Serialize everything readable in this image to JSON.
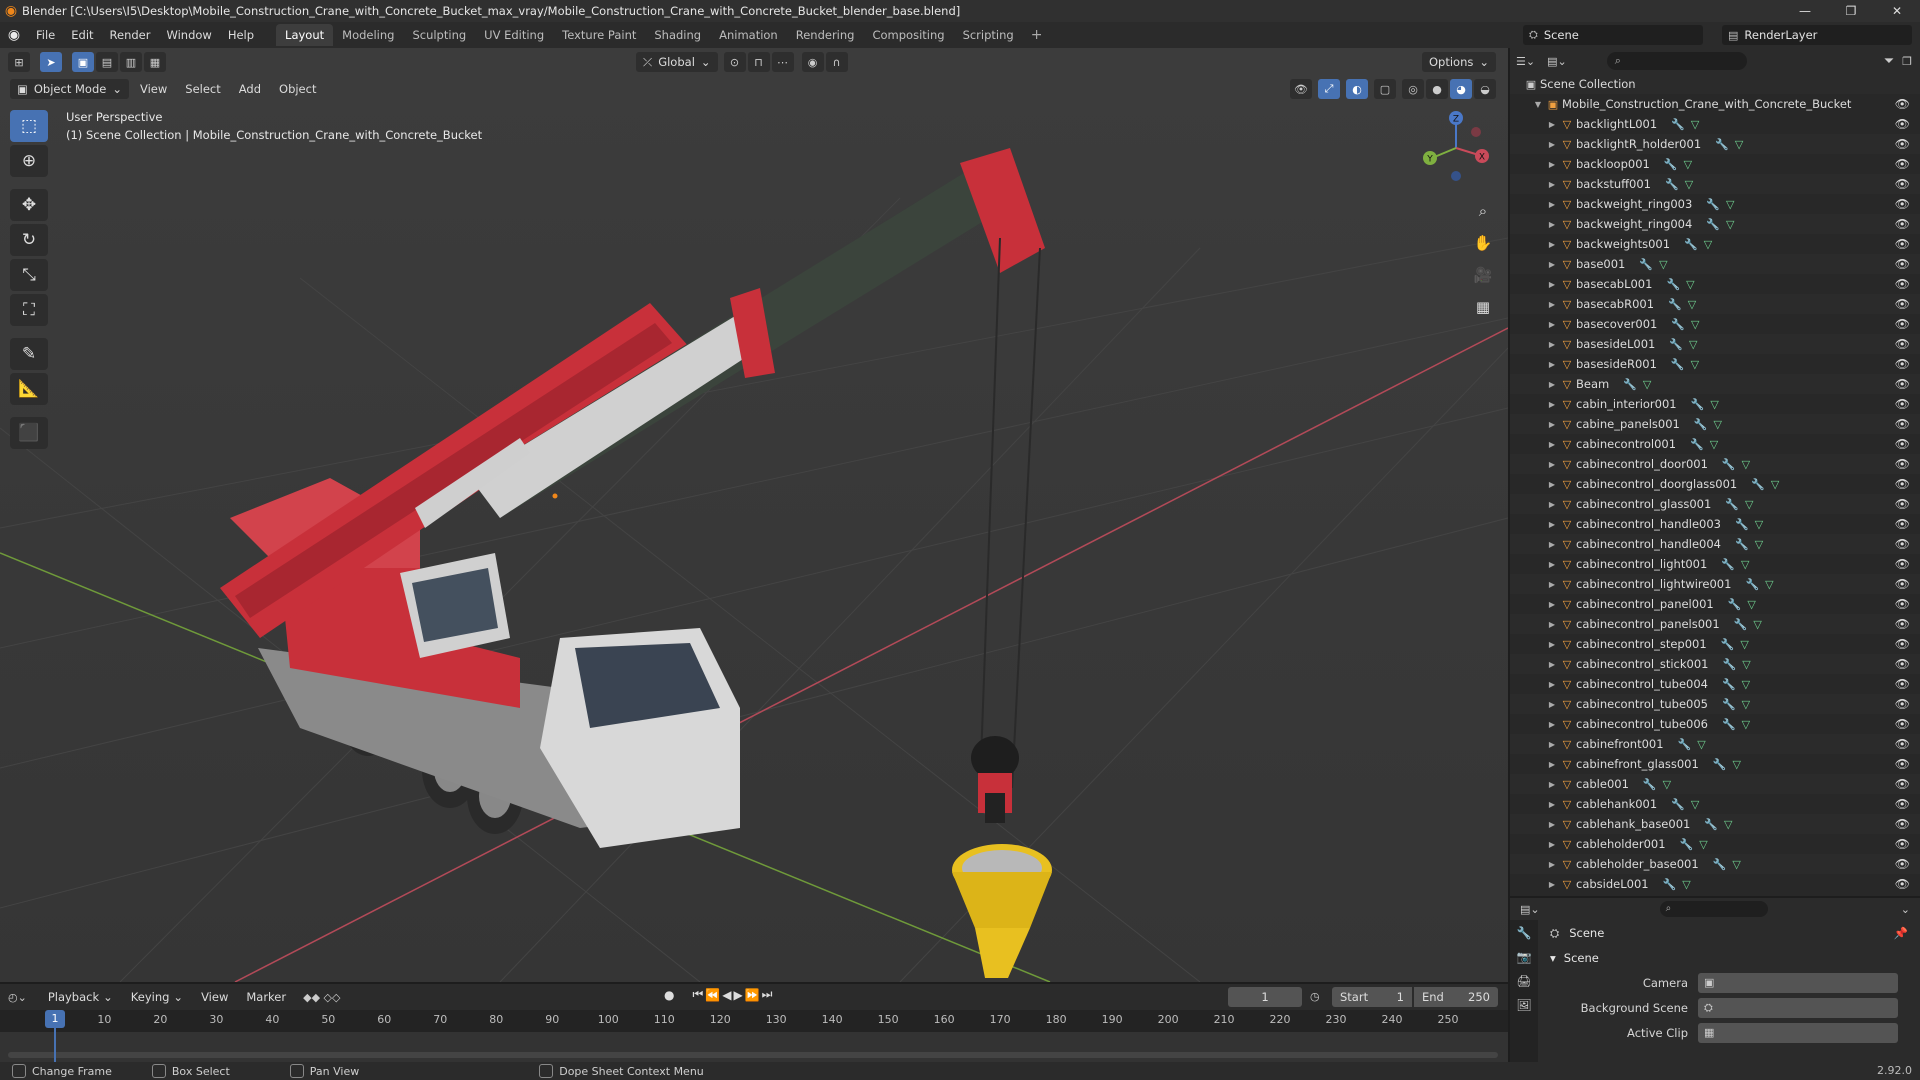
{
  "window": {
    "title": "Blender [C:\\Users\\I5\\Desktop\\Mobile_Construction_Crane_with_Concrete_Bucket_max_vray/Mobile_Construction_Crane_with_Concrete_Bucket_blender_base.blend]",
    "minimize": "—",
    "maximize": "❐",
    "close": "✕"
  },
  "menubar": {
    "menus": [
      "File",
      "Edit",
      "Render",
      "Window",
      "Help"
    ],
    "workspaces": [
      "Layout",
      "Modeling",
      "Sculpting",
      "UV Editing",
      "Texture Paint",
      "Shading",
      "Animation",
      "Rendering",
      "Compositing",
      "Scripting"
    ],
    "active_workspace": "Layout",
    "add": "+",
    "scene": "Scene",
    "render_layer": "RenderLayer"
  },
  "viewport": {
    "mode": "Object Mode",
    "menus": [
      "View",
      "Select",
      "Add",
      "Object"
    ],
    "transform_orientation": "Global",
    "options": "Options",
    "info_line1": "User Perspective",
    "info_line2": "(1) Scene Collection | Mobile_Construction_Crane_with_Concrete_Bucket",
    "gizmo": {
      "x": "X",
      "y": "Y",
      "z": "Z"
    }
  },
  "outliner": {
    "search_placeholder": "",
    "root": "Scene Collection",
    "collection": "Mobile_Construction_Crane_with_Concrete_Bucket",
    "items": [
      "backlightL001",
      "backlightR_holder001",
      "backloop001",
      "backstuff001",
      "backweight_ring003",
      "backweight_ring004",
      "backweights001",
      "base001",
      "basecabL001",
      "basecabR001",
      "basecover001",
      "basesideL001",
      "basesideR001",
      "Beam",
      "cabin_interior001",
      "cabine_panels001",
      "cabinecontrol001",
      "cabinecontrol_door001",
      "cabinecontrol_doorglass001",
      "cabinecontrol_glass001",
      "cabinecontrol_handle003",
      "cabinecontrol_handle004",
      "cabinecontrol_light001",
      "cabinecontrol_lightwire001",
      "cabinecontrol_panel001",
      "cabinecontrol_panels001",
      "cabinecontrol_step001",
      "cabinecontrol_stick001",
      "cabinecontrol_tube004",
      "cabinecontrol_tube005",
      "cabinecontrol_tube006",
      "cabinefront001",
      "cabinefront_glass001",
      "cable001",
      "cablehank001",
      "cablehank_base001",
      "cableholder001",
      "cableholder_base001",
      "cabsideL001"
    ]
  },
  "properties": {
    "title": "Scene",
    "section": "Scene",
    "fields": [
      {
        "label": "Camera",
        "value": ""
      },
      {
        "label": "Background Scene",
        "value": ""
      },
      {
        "label": "Active Clip",
        "value": ""
      }
    ]
  },
  "timeline": {
    "menus": [
      "Playback",
      "Keying",
      "View",
      "Marker"
    ],
    "current_frame": "1",
    "start_label": "Start",
    "start_value": "1",
    "end_label": "End",
    "end_value": "250",
    "ticks": [
      "10",
      "20",
      "30",
      "40",
      "50",
      "60",
      "70",
      "80",
      "90",
      "100",
      "110",
      "120",
      "130",
      "140",
      "150",
      "160",
      "170",
      "180",
      "190",
      "200",
      "210",
      "220",
      "230",
      "240",
      "250"
    ]
  },
  "statusbar": {
    "items": [
      "Change Frame",
      "Box Select",
      "Pan View",
      "Dope Sheet Context Menu"
    ],
    "version": "2.92.0"
  },
  "colors": {
    "accent": "#4772b3",
    "crane_red": "#c8303a",
    "bucket_yellow": "#e8c020",
    "x_axis": "#c94a5a",
    "y_axis": "#7fb040"
  }
}
